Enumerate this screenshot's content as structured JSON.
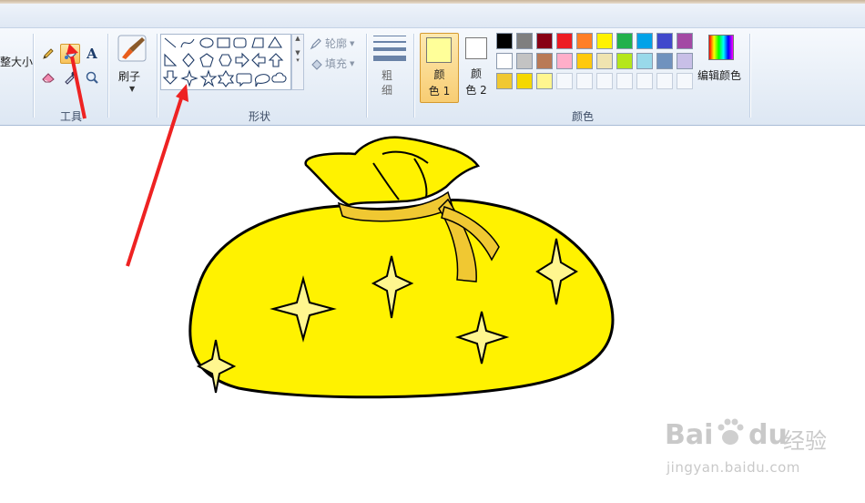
{
  "ribbon": {
    "resize_label": "重新调整大小",
    "resize_visible": "整大小",
    "groups": {
      "tools": "工具",
      "shapes": "形状",
      "colors": "颜色"
    },
    "brush_label": "刷子",
    "outline_label": "轮廓",
    "fill_label": "填充",
    "thickness_line1": "粗",
    "thickness_line2": "细",
    "color1_line1": "颜",
    "color1_line2": "色 1",
    "color2_line1": "颜",
    "color2_line2": "色 2",
    "edit_colors": "编辑颜色",
    "tool_text_glyph": "A"
  },
  "palette_colors": {
    "row1": [
      "#000000",
      "#7f7f7f",
      "#880015",
      "#ed1c24",
      "#ff7f27",
      "#fff200",
      "#22b14c",
      "#00a2e8",
      "#3f48cc",
      "#a349a4"
    ],
    "row2": [
      "#ffffff",
      "#c3c3c3",
      "#b97a57",
      "#ffaec9",
      "#ffc90e",
      "#efe4b0",
      "#b5e61d",
      "#99d9ea",
      "#7092be",
      "#c8bfe7"
    ],
    "row3": [
      "#f0c832",
      "#f5d800",
      "#fff68f"
    ]
  },
  "colors": {
    "color1": "#ffff99",
    "color2": "#ffffff",
    "bag_fill": "#fff200",
    "star_fill": "#fff68f",
    "ribbon_fill": "#f0c832",
    "annotation_arrow": "#ee2222"
  },
  "watermark": {
    "brand": "Bai",
    "brand2": "du",
    "brand_cn": "经验",
    "url": "jingyan.baidu.com"
  }
}
